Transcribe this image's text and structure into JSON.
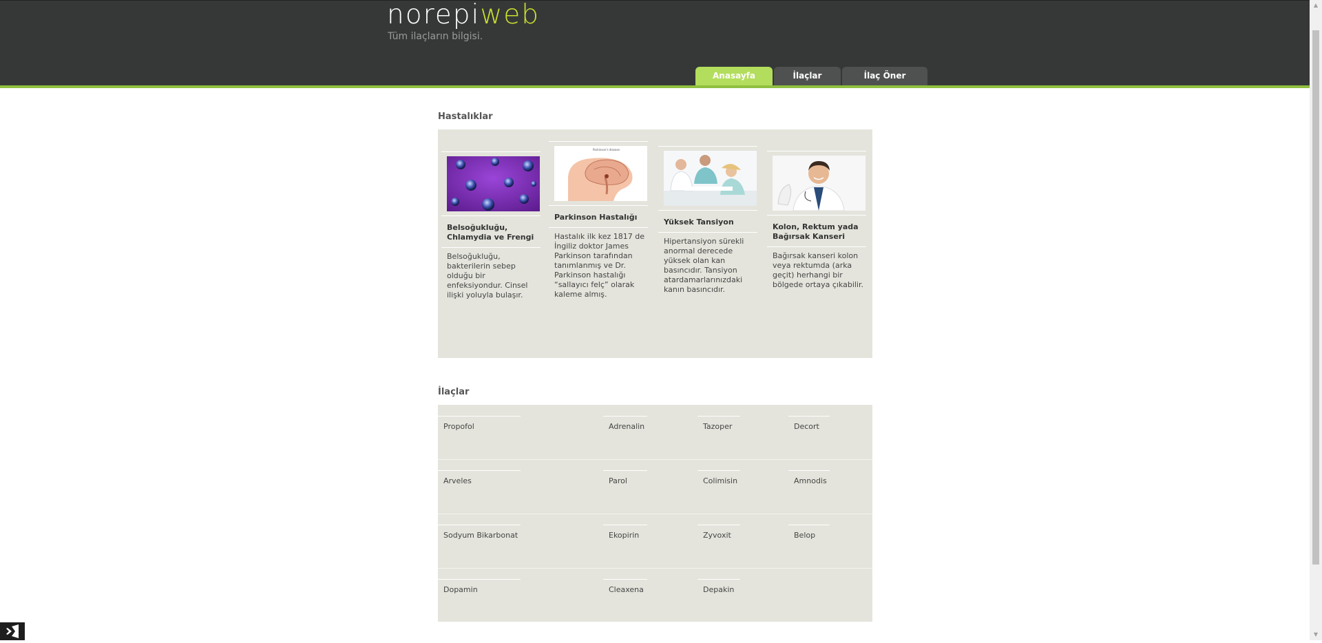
{
  "header": {
    "logo_main": "norepi",
    "logo_accent": "web",
    "tagline": "Tüm ilaçların bilgisi."
  },
  "nav": [
    {
      "label": "Anasayfa",
      "active": true
    },
    {
      "label": "İlaçlar",
      "active": false
    },
    {
      "label": "İlaç Öner",
      "active": false
    }
  ],
  "diseases": {
    "title": "Hastalıklar",
    "items": [
      {
        "title": "Belsoğukluğu, Chlamydia ve Frengi",
        "text": "Belsoğukluğu, bakterilerin sebep olduğu bir enfeksiyondur. Cinsel ilişki yoluyla bulaşır."
      },
      {
        "title": "Parkinson Hastalığı",
        "text": "Hastalık ilk kez 1817 de İngiliz doktor James Parkinson tarafından tanımlanmış ve Dr. Parkinson hastalığı “sallayıcı felç” olarak kaleme almış."
      },
      {
        "title": "Yüksek Tansiyon",
        "text": "Hipertansiyon sürekli anormal derecede yüksek olan kan basıncıdır. Tansiyon atardamarlarınızdaki kanın basıncıdır."
      },
      {
        "title": "Kolon, Rektum yada Bağırsak Kanseri",
        "text": "Bağırsak kanseri kolon veya rektumda (arka geçit) herhangi bir bölgede ortaya çıkabilir."
      }
    ],
    "parkinson_image_caption": "Parkinson's disease"
  },
  "drugs": {
    "title": "İlaçlar",
    "rows": [
      [
        "Propofol",
        "Adrenalin",
        "Tazoper",
        "Decort"
      ],
      [
        "Arveles",
        "Parol",
        "Colimisin",
        "Amnodis"
      ],
      [
        "Sodyum Bikarbonat",
        "Ekopirin",
        "Zyvoxit",
        "Belop"
      ],
      [
        "Dopamin",
        "Cleaxena",
        "Depakin",
        ""
      ]
    ]
  },
  "colors": {
    "header_bg": "#363838",
    "accent_line": "#8fbf3f",
    "active_tab": "#b3dd5c",
    "panel_bg": "#e4e4dc",
    "logo_accent": "#cbe02e"
  }
}
